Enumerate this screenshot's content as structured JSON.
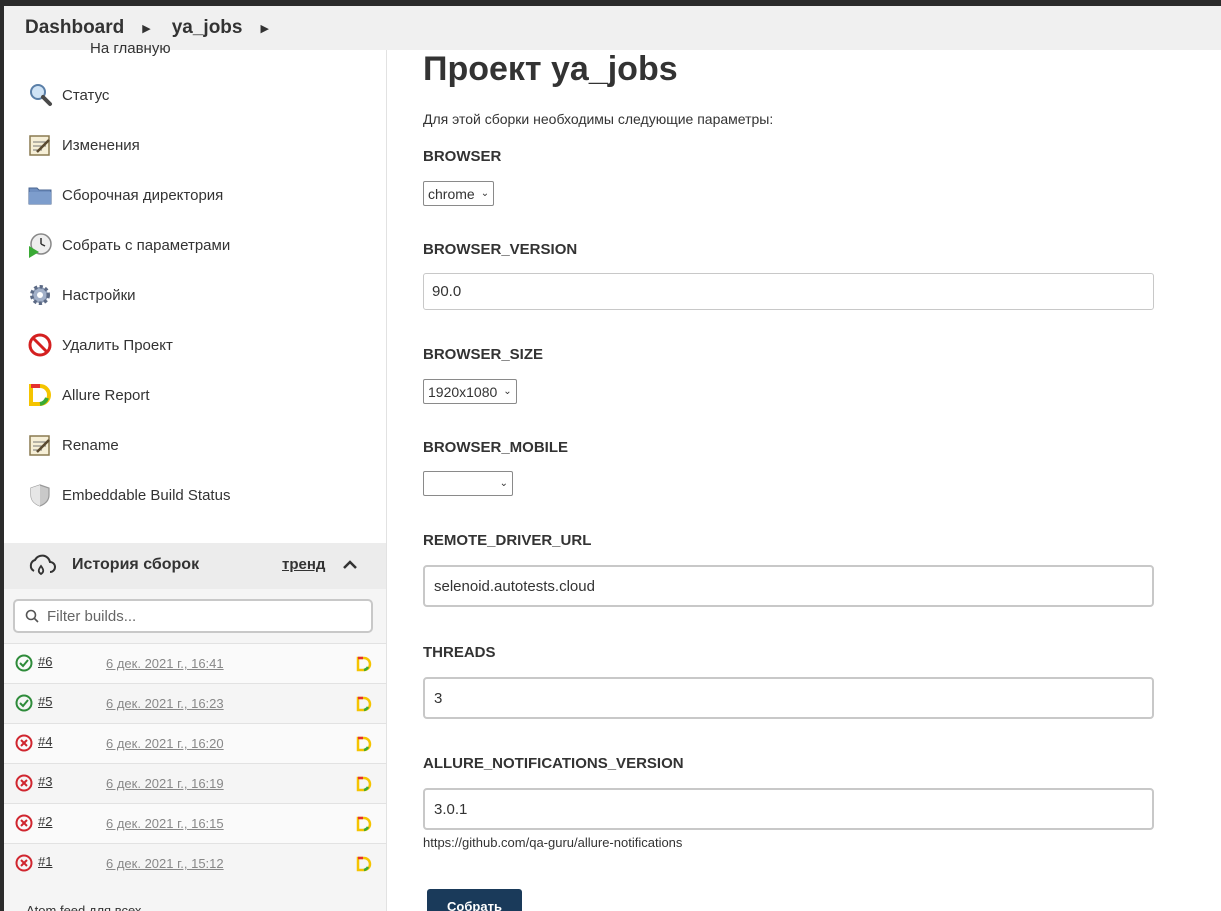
{
  "breadcrumb": {
    "items": [
      "Dashboard",
      "ya_jobs"
    ]
  },
  "sidebar": {
    "partial_label": "На главную",
    "tasks": [
      {
        "label": "Статус",
        "icon": "search-icon"
      },
      {
        "label": "Изменения",
        "icon": "notepad-icon"
      },
      {
        "label": "Сборочная директория",
        "icon": "folder-icon"
      },
      {
        "label": "Собрать с параметрами",
        "icon": "clock-play-icon"
      },
      {
        "label": "Настройки",
        "icon": "gear-icon"
      },
      {
        "label": "Удалить Проект",
        "icon": "no-entry-icon"
      },
      {
        "label": "Allure Report",
        "icon": "allure-icon"
      },
      {
        "label": "Rename",
        "icon": "notepad-icon"
      },
      {
        "label": "Embeddable Build Status",
        "icon": "shield-icon"
      }
    ]
  },
  "build_history": {
    "title": "История сборок",
    "trend": "тренд",
    "filter_placeholder": "Filter builds...",
    "builds": [
      {
        "number": "#6",
        "date": "6 дек. 2021 г., 16:41",
        "status": "success"
      },
      {
        "number": "#5",
        "date": "6 дек. 2021 г., 16:23",
        "status": "success"
      },
      {
        "number": "#4",
        "date": "6 дек. 2021 г., 16:20",
        "status": "failed"
      },
      {
        "number": "#3",
        "date": "6 дек. 2021 г., 16:19",
        "status": "failed"
      },
      {
        "number": "#2",
        "date": "6 дек. 2021 г., 16:15",
        "status": "failed"
      },
      {
        "number": "#1",
        "date": "6 дек. 2021 г., 15:12",
        "status": "failed"
      }
    ],
    "atom_label": "Atom feed для всех"
  },
  "main": {
    "title": "Проект ya_jobs",
    "description": "Для этой сборки необходимы следующие параметры:",
    "params": {
      "browser": {
        "label": "BROWSER",
        "value": "chrome"
      },
      "browser_version": {
        "label": "BROWSER_VERSION",
        "value": "90.0"
      },
      "browser_size": {
        "label": "BROWSER_SIZE",
        "value": "1920x1080"
      },
      "browser_mobile": {
        "label": "BROWSER_MOBILE",
        "value": ""
      },
      "remote_driver_url": {
        "label": "REMOTE_DRIVER_URL",
        "value": "selenoid.autotests.cloud"
      },
      "threads": {
        "label": "THREADS",
        "value": "3"
      },
      "allure_notifications_version": {
        "label": "ALLURE_NOTIFICATIONS_VERSION",
        "value": "3.0.1",
        "hint": "https://github.com/qa-guru/allure-notifications"
      }
    },
    "submit_label": "Собрать"
  },
  "colors": {
    "success": "#2e8b3a",
    "failed": "#d0262f",
    "submit": "#1a3a5a"
  }
}
